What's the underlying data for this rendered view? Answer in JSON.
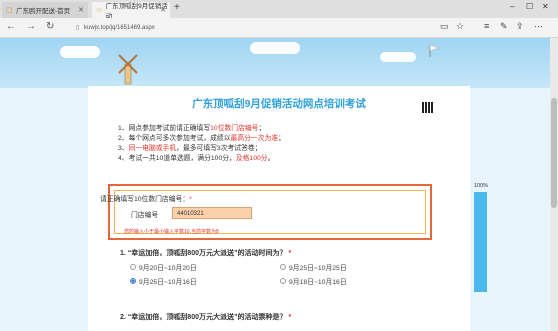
{
  "browser": {
    "tabs": [
      {
        "label": "广东鸥开配送-首页",
        "active": false
      },
      {
        "label": "广东顶呱刮9月促销活动",
        "active": true
      }
    ],
    "new_tab_symbol": "+",
    "url": "kuwjx.top/jq/1651469.aspx"
  },
  "exam": {
    "title": "广东顶呱刮9月促销活动网点培训考试",
    "rules": [
      {
        "text_before": "1、网点参加考试前请正确填写",
        "highlight": "10位数门店编号",
        "text_after": "；"
      },
      {
        "text_before": "2、每个网点可多次参加考试，成绩以",
        "highlight": "最高分一次为准",
        "text_after": "；"
      },
      {
        "text_before": "3、",
        "highlight": "同一电脑或手机",
        "text_after": "，最多可填写3次考试答卷；"
      },
      {
        "text_before": "4、考试一共10道单选题，满分100分，",
        "highlight": "及格100分",
        "text_after": "。"
      }
    ],
    "store_section": {
      "label": "请正确填写10位数门店编号：",
      "required_mark": "*",
      "field_label": "门店编号",
      "field_value": "44010321",
      "error": "您的输入小于最小输入字数10,当前字数为8"
    },
    "questions": [
      {
        "number": "1.",
        "text": "“幸运加倍，顶呱刮800万元大派送”的活动时间为？",
        "required_mark": "*",
        "options": [
          {
            "label": "9月20日~10月20日",
            "selected": false
          },
          {
            "label": "9月25日~10月25日",
            "selected": false
          },
          {
            "label": "9月25日~10月16日",
            "selected": true
          },
          {
            "label": "9月18日~10月16日",
            "selected": false
          }
        ]
      },
      {
        "number": "2.",
        "text": "“幸运加倍，顶呱刮800万元大派送”的活动票种是？",
        "required_mark": "*"
      }
    ]
  },
  "progress": {
    "label": "100%",
    "value": 1.0
  }
}
